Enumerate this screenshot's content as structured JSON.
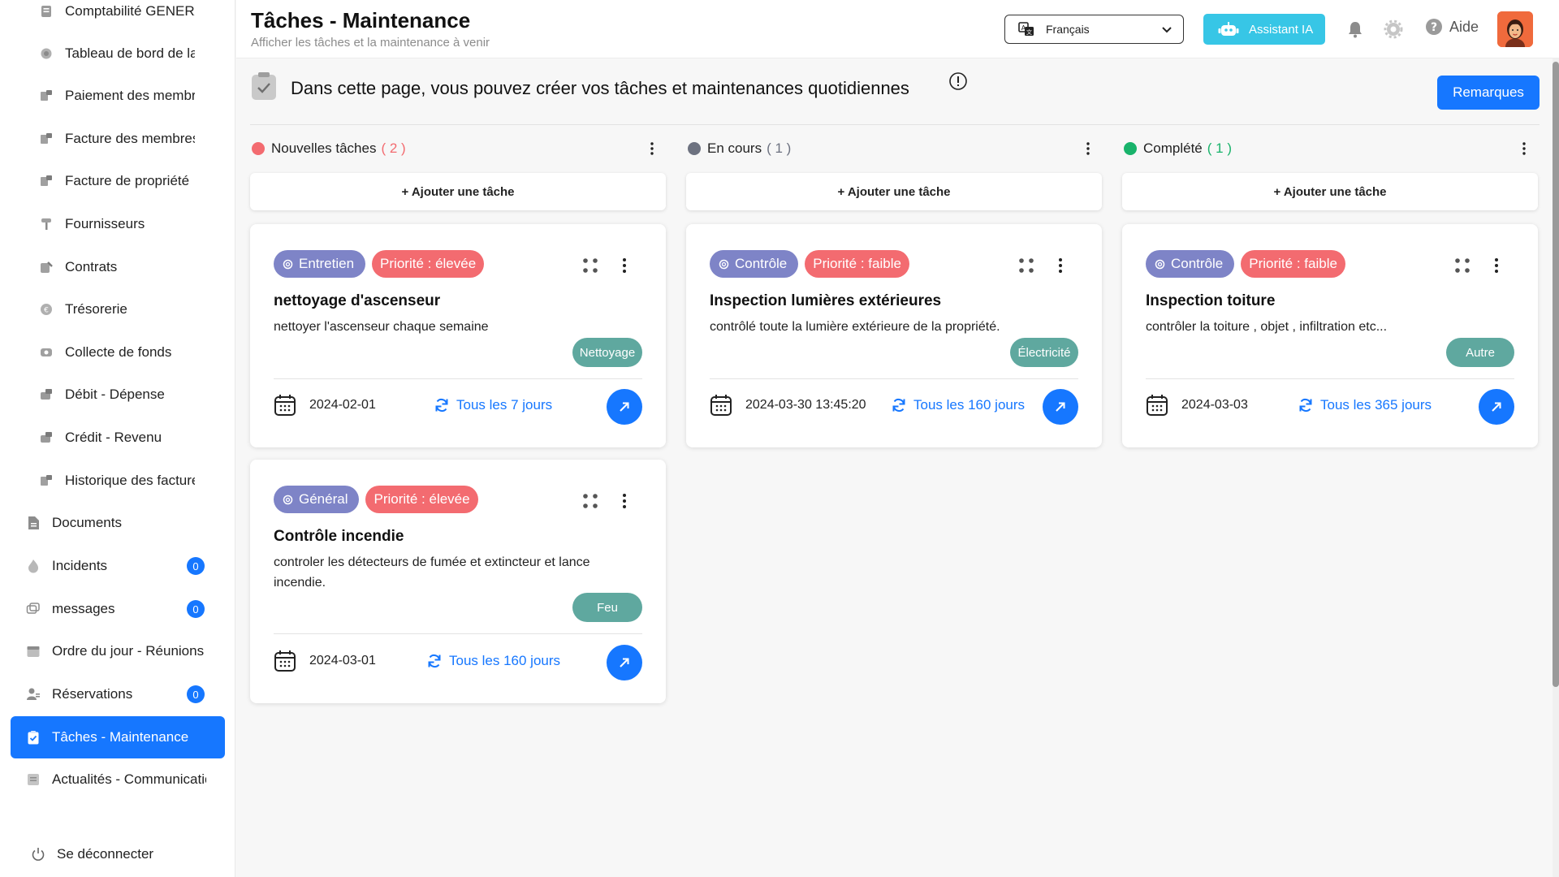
{
  "sidebar": {
    "sub_items": [
      {
        "label": "Comptabilité GENERALE",
        "icon": "ledger-icon"
      },
      {
        "label": "Tableau de bord de la copropriété",
        "icon": "dashboard-icon"
      },
      {
        "label": "Paiement des membres",
        "icon": "payment-icon"
      },
      {
        "label": "Facture des membres",
        "icon": "invoice-icon"
      },
      {
        "label": "Facture de propriété",
        "icon": "property-invoice-icon"
      },
      {
        "label": "Fournisseurs",
        "icon": "supplier-icon"
      },
      {
        "label": "Contrats",
        "icon": "contract-icon"
      },
      {
        "label": "Trésorerie",
        "icon": "treasury-icon"
      },
      {
        "label": "Collecte de fonds",
        "icon": "fundraising-icon"
      },
      {
        "label": "Débit - Dépense",
        "icon": "debit-icon"
      },
      {
        "label": "Crédit - Revenu",
        "icon": "credit-icon"
      },
      {
        "label": "Historique des factures",
        "icon": "history-icon"
      }
    ],
    "main_items": [
      {
        "label": "Documents",
        "icon": "document-icon",
        "badge": null
      },
      {
        "label": "Incidents",
        "icon": "fire-icon",
        "badge": "0"
      },
      {
        "label": "messages",
        "icon": "message-icon",
        "badge": "0"
      },
      {
        "label": "Ordre du jour - Réunions",
        "icon": "calendar-icon",
        "badge": null
      },
      {
        "label": "Réservations",
        "icon": "users-icon",
        "badge": "0"
      },
      {
        "label": "Tâches - Maintenance",
        "icon": "clipboard-check-icon",
        "badge": null,
        "active": true
      },
      {
        "label": "Actualités - Communications",
        "icon": "news-icon",
        "badge": null
      }
    ],
    "logout_label": "Se déconnecter"
  },
  "header": {
    "title": "Tâches - Maintenance",
    "subtitle": "Afficher les tâches et la maintenance à venir",
    "language": "Français",
    "ai_button": "Assistant IA",
    "help_label": "Aide"
  },
  "info": {
    "text": "Dans cette page, vous pouvez créer vos tâches et maintenances quotidiennes",
    "remarks_button": "Remarques"
  },
  "columns": [
    {
      "name": "Nouvelles tâches",
      "count": "( 2 )",
      "dot_color": "#f36b70",
      "count_color": "#f36b70",
      "add_label": "+ Ajouter une tâche"
    },
    {
      "name": "En cours",
      "count": "( 1 )",
      "dot_color": "#6d7280",
      "count_color": "#6d7280",
      "add_label": "+ Ajouter une tâche"
    },
    {
      "name": "Complété",
      "count": "( 1 )",
      "dot_color": "#19b36b",
      "count_color": "#19b36b",
      "add_label": "+ Ajouter une tâche"
    }
  ],
  "cards": [
    {
      "category": "Entretien",
      "priority": "Priorité : élevée",
      "title": "nettoyage d'ascenseur",
      "description": "nettoyer l'ascenseur chaque semaine",
      "type": "Nettoyage",
      "date": "2024-02-01",
      "repeat": "Tous les 7 jours"
    },
    {
      "category": "Contrôle",
      "priority": "Priorité : faible",
      "title": "Inspection lumières extérieures",
      "description": "contrôlé toute la lumière extérieure de la propriété.",
      "type": "Électricité",
      "date": "2024-03-30 13:45:20",
      "repeat": "Tous les 160 jours"
    },
    {
      "category": "Contrôle",
      "priority": "Priorité : faible",
      "title": "Inspection toiture",
      "description": "contrôler la toiture , objet , infiltration etc...",
      "type": "Autre",
      "date": "2024-03-03",
      "repeat": "Tous les 365 jours"
    },
    {
      "category": "Général",
      "priority": "Priorité : élevée",
      "title": "Contrôle incendie",
      "description": "controler les détecteurs de fumée et extincteur et lance incendie.",
      "type": "Feu",
      "date": "2024-03-01",
      "repeat": "Tous les 160 jours"
    }
  ],
  "colors": {
    "accent": "#1677ff",
    "category_tag": "#7e84c7",
    "priority_tag": "#f36b70",
    "type_tag": "#5fa89f",
    "ai_button": "#37c6e6"
  }
}
